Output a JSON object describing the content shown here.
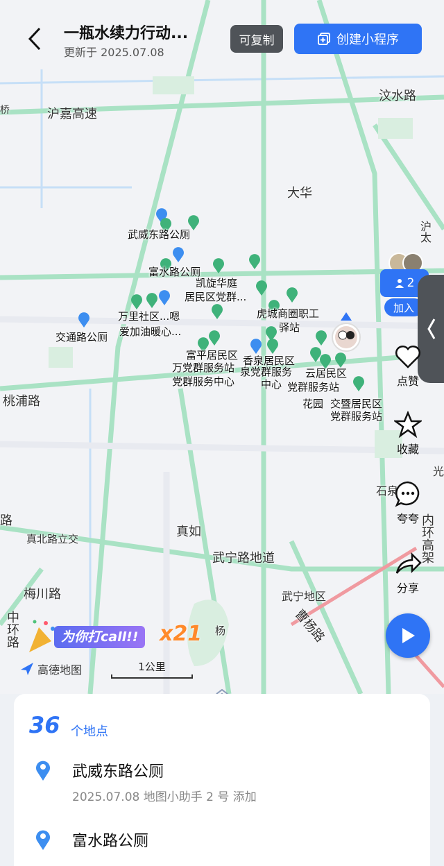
{
  "header": {
    "title": "一瓶水续力行动...",
    "updated": "更新于 2025.07.08",
    "copy_label": "可复制",
    "create_label": "创建小程序"
  },
  "map": {
    "roads": {
      "r1": "沪嘉高速",
      "r2": "汶水路",
      "r3": "桃浦路",
      "r4": "真北路立交",
      "r5": "梅川路",
      "r6": "武宁路地道",
      "r7": "曹杨路",
      "r8": "中环路",
      "r9": "内环高架",
      "r10": "大华",
      "r11": "真如",
      "r12": "武宁地区",
      "r13": "桥",
      "r14": "石泉",
      "r15": "沪太",
      "r16": "路",
      "r17": "武宁",
      "r18": "杨",
      "r19": "光"
    },
    "places": {
      "p1": "武威东路公厕",
      "p2": "富水路公厕",
      "p3": "凯旋华庭",
      "p4": "居民区党群...",
      "p5": "虎城商圈职工",
      "p6": "驿站",
      "p7": "万里社区...嗯",
      "p8": "爱加油暖心...",
      "p9": "交通路公厕",
      "p10": "富平居民区",
      "p11": "万党群服务站",
      "p12": "党群服务中心",
      "p13": "香泉居民区",
      "p14": "泉党群服务",
      "p15": "中心",
      "p16": "云居民区",
      "p17": "党群服务站",
      "p18": "花园",
      "p19": "交暨居民区",
      "p20": "党群服务站"
    },
    "brand": "高德地图",
    "scale": "1公里",
    "call_text": "为你打call!!",
    "call_count": "x21"
  },
  "side": {
    "member_count": "2",
    "join": "加入",
    "like": "点赞",
    "favorite": "收藏",
    "praise": "夸夸",
    "share": "分享"
  },
  "sheet": {
    "count": "36",
    "count_label": "个地点",
    "items": [
      {
        "title": "武威东路公厕",
        "sub": "2025.07.08 地图小助手 2 号 添加"
      },
      {
        "title": "富水路公厕",
        "sub": ""
      }
    ]
  },
  "colors": {
    "accent": "#2f74f5",
    "road": "#9fd7be",
    "pin_green": "#3fb27a",
    "pin_blue": "#3d8ef0"
  }
}
